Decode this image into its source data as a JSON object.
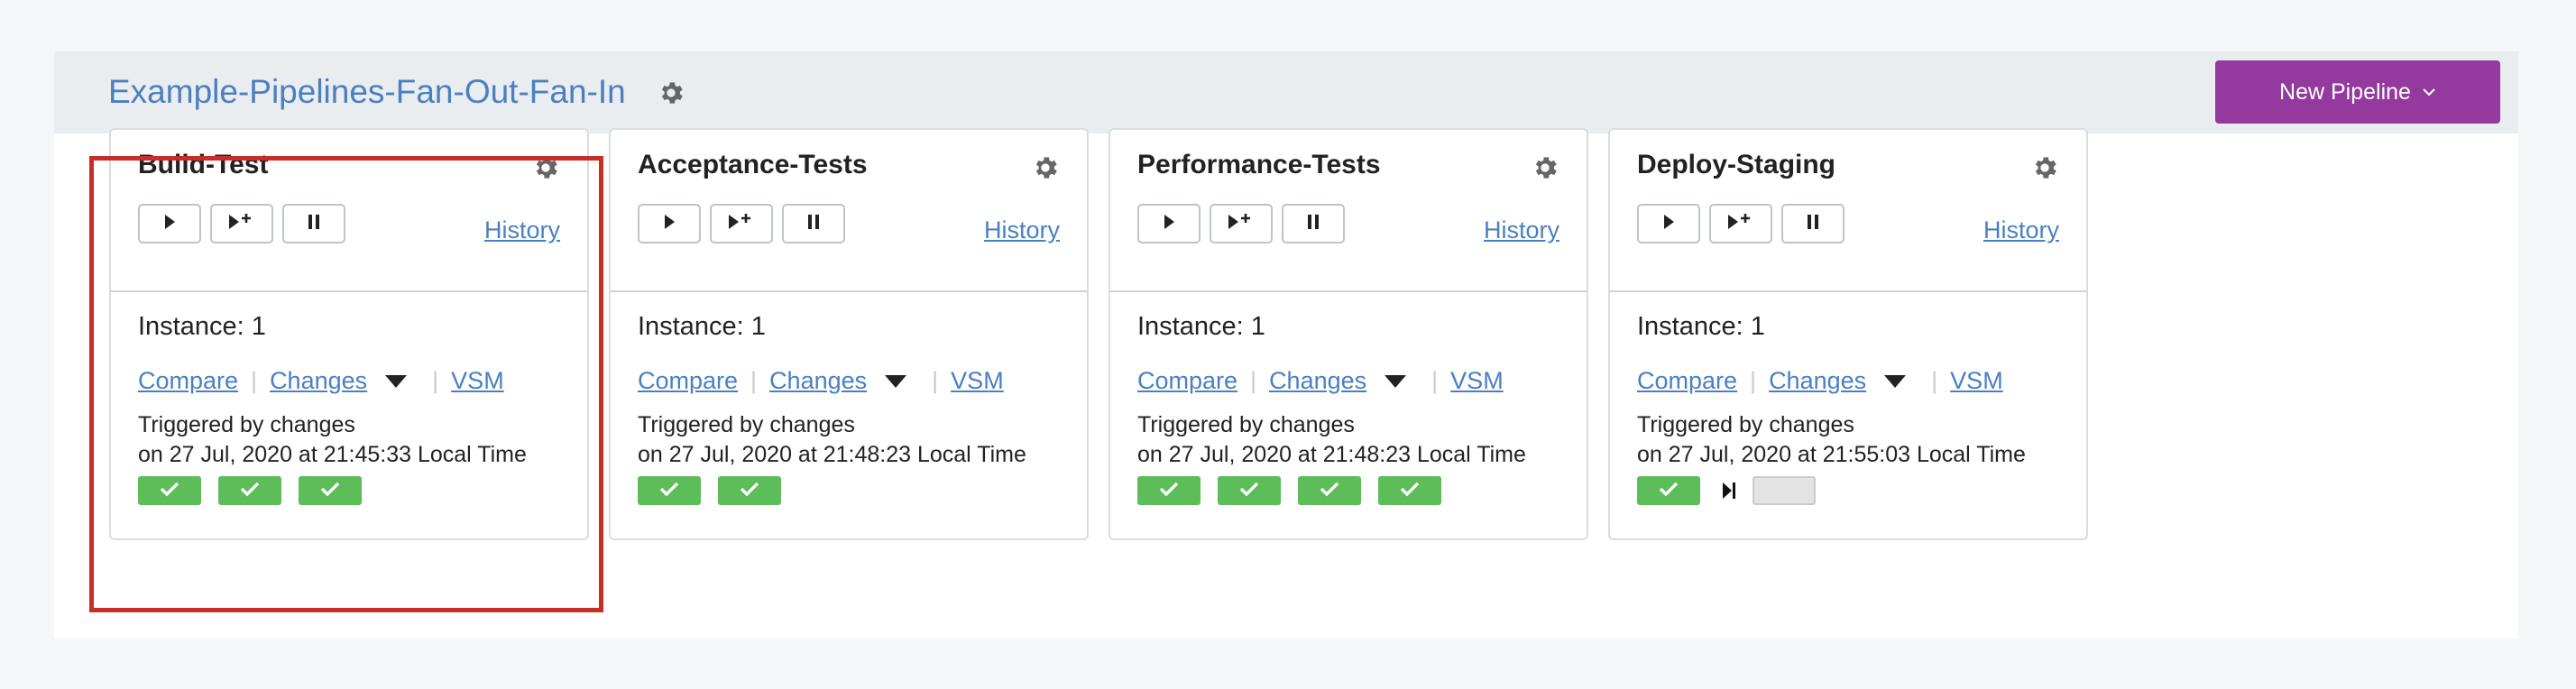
{
  "group": {
    "title": "Example-Pipelines-Fan-Out-Fan-In",
    "new_pipeline_label": "New Pipeline",
    "accent_color": "#943a9e",
    "link_color": "#4a7fc1"
  },
  "pipelines": [
    {
      "name": "Build-Test",
      "history": "History",
      "instance": "Instance: 1",
      "compare": "Compare",
      "changes": "Changes",
      "vsm": "VSM",
      "triggered_by": "Triggered by changes",
      "triggered_on": "on 27 Jul, 2020 at 21:45:33 Local Time",
      "stages": [
        "passed",
        "passed",
        "passed"
      ],
      "highlighted": true
    },
    {
      "name": "Acceptance-Tests",
      "history": "History",
      "instance": "Instance: 1",
      "compare": "Compare",
      "changes": "Changes",
      "vsm": "VSM",
      "triggered_by": "Triggered by changes",
      "triggered_on": "on 27 Jul, 2020 at 21:48:23 Local Time",
      "stages": [
        "passed",
        "passed"
      ]
    },
    {
      "name": "Performance-Tests",
      "history": "History",
      "instance": "Instance: 1",
      "compare": "Compare",
      "changes": "Changes",
      "vsm": "VSM",
      "triggered_by": "Triggered by changes",
      "triggered_on": "on 27 Jul, 2020 at 21:48:23 Local Time",
      "stages": [
        "passed",
        "passed",
        "passed",
        "passed"
      ]
    },
    {
      "name": "Deploy-Staging",
      "history": "History",
      "instance": "Instance: 1",
      "compare": "Compare",
      "changes": "Changes",
      "vsm": "VSM",
      "triggered_by": "Triggered by changes",
      "triggered_on": "on 27 Jul, 2020 at 21:55:03 Local Time",
      "stages": [
        "passed",
        "manual-gate",
        "pending"
      ]
    }
  ],
  "icons": {
    "settings": "gear-icon",
    "trigger": "play-icon",
    "trigger_with_options": "play-plus-icon",
    "pause": "pause-icon",
    "stage_passed": "check-icon",
    "manual_gate": "skip-forward-icon",
    "changes_dropdown": "caret-down-icon"
  }
}
